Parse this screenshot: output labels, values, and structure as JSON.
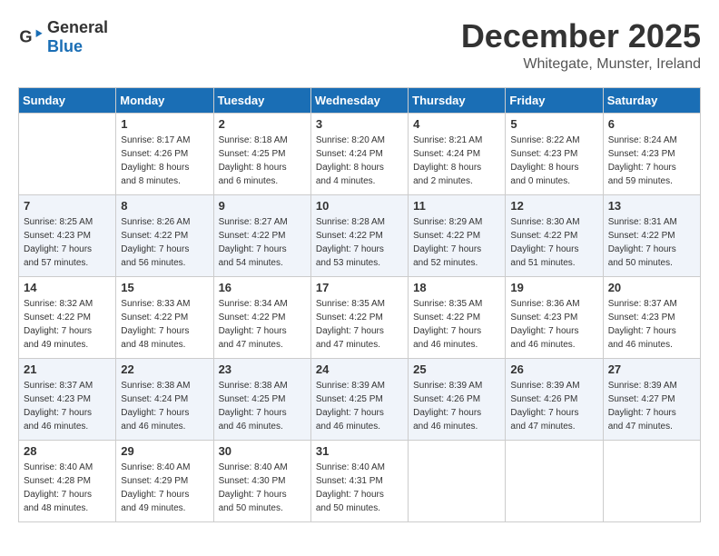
{
  "header": {
    "logo_general": "General",
    "logo_blue": "Blue",
    "month": "December 2025",
    "location": "Whitegate, Munster, Ireland"
  },
  "days_of_week": [
    "Sunday",
    "Monday",
    "Tuesday",
    "Wednesday",
    "Thursday",
    "Friday",
    "Saturday"
  ],
  "weeks": [
    [
      {
        "day": "",
        "info": ""
      },
      {
        "day": "1",
        "info": "Sunrise: 8:17 AM\nSunset: 4:26 PM\nDaylight: 8 hours\nand 8 minutes."
      },
      {
        "day": "2",
        "info": "Sunrise: 8:18 AM\nSunset: 4:25 PM\nDaylight: 8 hours\nand 6 minutes."
      },
      {
        "day": "3",
        "info": "Sunrise: 8:20 AM\nSunset: 4:24 PM\nDaylight: 8 hours\nand 4 minutes."
      },
      {
        "day": "4",
        "info": "Sunrise: 8:21 AM\nSunset: 4:24 PM\nDaylight: 8 hours\nand 2 minutes."
      },
      {
        "day": "5",
        "info": "Sunrise: 8:22 AM\nSunset: 4:23 PM\nDaylight: 8 hours\nand 0 minutes."
      },
      {
        "day": "6",
        "info": "Sunrise: 8:24 AM\nSunset: 4:23 PM\nDaylight: 7 hours\nand 59 minutes."
      }
    ],
    [
      {
        "day": "7",
        "info": "Sunrise: 8:25 AM\nSunset: 4:23 PM\nDaylight: 7 hours\nand 57 minutes."
      },
      {
        "day": "8",
        "info": "Sunrise: 8:26 AM\nSunset: 4:22 PM\nDaylight: 7 hours\nand 56 minutes."
      },
      {
        "day": "9",
        "info": "Sunrise: 8:27 AM\nSunset: 4:22 PM\nDaylight: 7 hours\nand 54 minutes."
      },
      {
        "day": "10",
        "info": "Sunrise: 8:28 AM\nSunset: 4:22 PM\nDaylight: 7 hours\nand 53 minutes."
      },
      {
        "day": "11",
        "info": "Sunrise: 8:29 AM\nSunset: 4:22 PM\nDaylight: 7 hours\nand 52 minutes."
      },
      {
        "day": "12",
        "info": "Sunrise: 8:30 AM\nSunset: 4:22 PM\nDaylight: 7 hours\nand 51 minutes."
      },
      {
        "day": "13",
        "info": "Sunrise: 8:31 AM\nSunset: 4:22 PM\nDaylight: 7 hours\nand 50 minutes."
      }
    ],
    [
      {
        "day": "14",
        "info": "Sunrise: 8:32 AM\nSunset: 4:22 PM\nDaylight: 7 hours\nand 49 minutes."
      },
      {
        "day": "15",
        "info": "Sunrise: 8:33 AM\nSunset: 4:22 PM\nDaylight: 7 hours\nand 48 minutes."
      },
      {
        "day": "16",
        "info": "Sunrise: 8:34 AM\nSunset: 4:22 PM\nDaylight: 7 hours\nand 47 minutes."
      },
      {
        "day": "17",
        "info": "Sunrise: 8:35 AM\nSunset: 4:22 PM\nDaylight: 7 hours\nand 47 minutes."
      },
      {
        "day": "18",
        "info": "Sunrise: 8:35 AM\nSunset: 4:22 PM\nDaylight: 7 hours\nand 46 minutes."
      },
      {
        "day": "19",
        "info": "Sunrise: 8:36 AM\nSunset: 4:23 PM\nDaylight: 7 hours\nand 46 minutes."
      },
      {
        "day": "20",
        "info": "Sunrise: 8:37 AM\nSunset: 4:23 PM\nDaylight: 7 hours\nand 46 minutes."
      }
    ],
    [
      {
        "day": "21",
        "info": "Sunrise: 8:37 AM\nSunset: 4:23 PM\nDaylight: 7 hours\nand 46 minutes."
      },
      {
        "day": "22",
        "info": "Sunrise: 8:38 AM\nSunset: 4:24 PM\nDaylight: 7 hours\nand 46 minutes."
      },
      {
        "day": "23",
        "info": "Sunrise: 8:38 AM\nSunset: 4:25 PM\nDaylight: 7 hours\nand 46 minutes."
      },
      {
        "day": "24",
        "info": "Sunrise: 8:39 AM\nSunset: 4:25 PM\nDaylight: 7 hours\nand 46 minutes."
      },
      {
        "day": "25",
        "info": "Sunrise: 8:39 AM\nSunset: 4:26 PM\nDaylight: 7 hours\nand 46 minutes."
      },
      {
        "day": "26",
        "info": "Sunrise: 8:39 AM\nSunset: 4:26 PM\nDaylight: 7 hours\nand 47 minutes."
      },
      {
        "day": "27",
        "info": "Sunrise: 8:39 AM\nSunset: 4:27 PM\nDaylight: 7 hours\nand 47 minutes."
      }
    ],
    [
      {
        "day": "28",
        "info": "Sunrise: 8:40 AM\nSunset: 4:28 PM\nDaylight: 7 hours\nand 48 minutes."
      },
      {
        "day": "29",
        "info": "Sunrise: 8:40 AM\nSunset: 4:29 PM\nDaylight: 7 hours\nand 49 minutes."
      },
      {
        "day": "30",
        "info": "Sunrise: 8:40 AM\nSunset: 4:30 PM\nDaylight: 7 hours\nand 50 minutes."
      },
      {
        "day": "31",
        "info": "Sunrise: 8:40 AM\nSunset: 4:31 PM\nDaylight: 7 hours\nand 50 minutes."
      },
      {
        "day": "",
        "info": ""
      },
      {
        "day": "",
        "info": ""
      },
      {
        "day": "",
        "info": ""
      }
    ]
  ]
}
